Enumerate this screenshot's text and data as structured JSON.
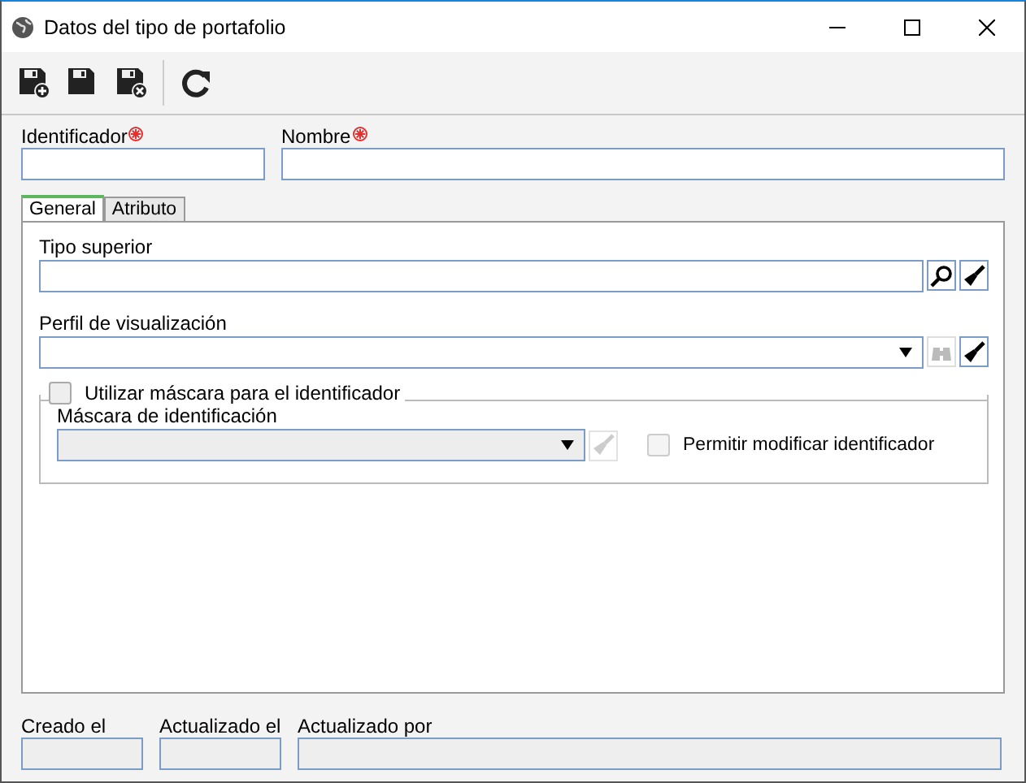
{
  "window": {
    "title": "Datos del tipo de portafolio"
  },
  "fields": [
    {
      "label": "Identificador",
      "required": true
    },
    {
      "label": "Nombre",
      "required": true
    }
  ],
  "tabs": [
    {
      "label": "General",
      "selected": true
    },
    {
      "label": "Atributo",
      "selected": false
    }
  ],
  "general": {
    "tipo_superior": {
      "label": "Tipo superior"
    },
    "perfil": {
      "label": "Perfil de visualización"
    },
    "mask_group": {
      "label": "Utilizar máscara para el identificador",
      "checked": false,
      "mask_field": {
        "label": "Máscara de identificación",
        "disabled": true
      },
      "allow_modify": {
        "label": "Permitir modificar identificador",
        "checked": false,
        "disabled": true
      }
    }
  },
  "footer": [
    {
      "label": "Creado el"
    },
    {
      "label": "Actualizado el"
    },
    {
      "label": "Actualizado por"
    }
  ]
}
